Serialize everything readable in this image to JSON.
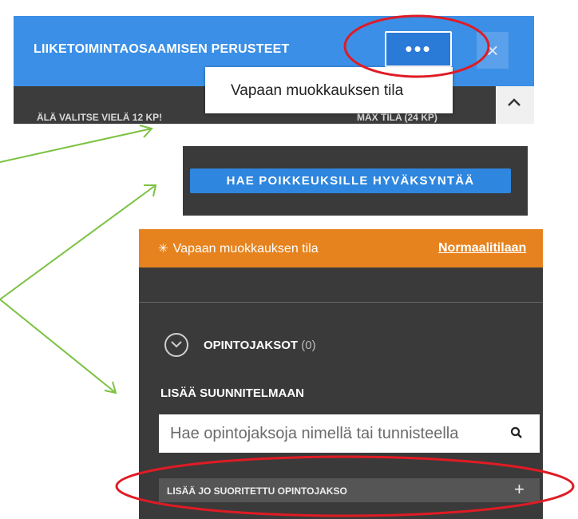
{
  "panel1": {
    "title": "LIIKETOIMINTAOSAAMISEN PERUSTEET",
    "more_button": "•••",
    "close_button": "×",
    "menu_item": "Vapaan muokkauksen tila",
    "truncated_left": "ÄLÄ VALITSE VIELÄ 12 KP!",
    "truncated_right": "MAX TILA (24 KP)",
    "scroll_up": "^"
  },
  "panel2": {
    "button": "HAE POIKKEUKSILLE HYVÄKSYNTÄÄ"
  },
  "panel3": {
    "mode_icon": "✳",
    "mode_text": "Vapaan muokkauksen tila",
    "normal_link": "Normaalitilaan",
    "courses_label": "OPINTOJAKSOT",
    "courses_count": "(0)",
    "add_label": "LISÄÄ SUUNNITELMAAN",
    "search_placeholder": "Hae opintojaksoja nimellä tai tunnisteella",
    "add_completed": "LISÄÄ JO SUORITETTU OPINTOJAKSO",
    "add_icon": "+"
  },
  "colors": {
    "header_blue": "#3b8fe6",
    "button_blue": "#2e86de",
    "dark_panel": "#3a3a3a",
    "mode_orange": "#e6831f",
    "annotation_red": "#e01b24",
    "annotation_green": "#7cc242"
  },
  "icons": {
    "close": "close-icon",
    "chevron_up": "chevron-up-icon",
    "chevron_down_circle": "chevron-down-circle-icon",
    "search": "search-icon",
    "plus": "plus-icon",
    "sparkle": "sparkle-icon"
  }
}
